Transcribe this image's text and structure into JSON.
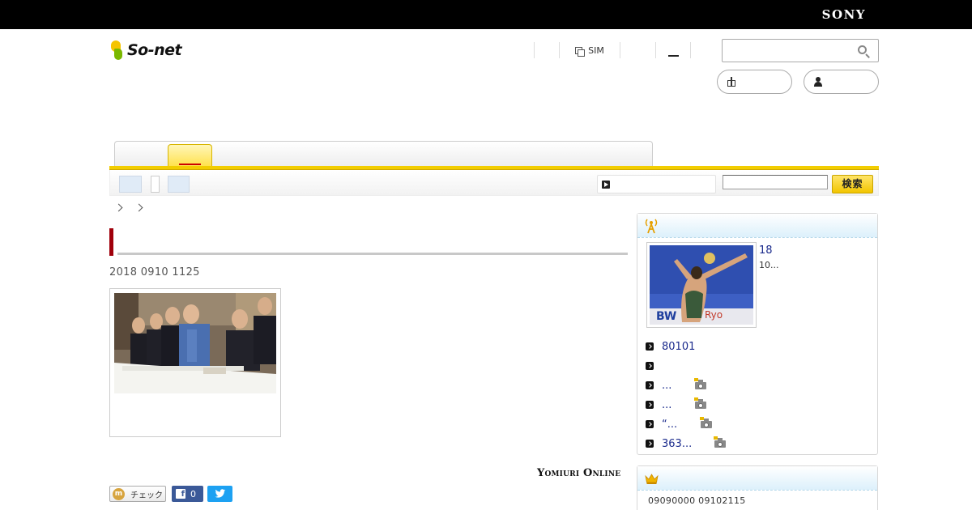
{
  "brand_bar": {
    "label": "SONY"
  },
  "header": {
    "logo_text": "So-net",
    "links": [
      {
        "label": ""
      },
      {
        "label": "SIM",
        "icon": "sim-icon"
      },
      {
        "label": ""
      },
      {
        "label": ""
      }
    ],
    "search": {
      "value": "",
      "placeholder": ""
    },
    "pills": [
      {
        "icon": "gift-icon",
        "label": ""
      },
      {
        "icon": "user-icon",
        "label": ""
      }
    ]
  },
  "subnav": {
    "search_value": "",
    "search_button": "検索"
  },
  "article": {
    "title": "",
    "date": "2018 0910 1125",
    "source": "Yomiuri Online"
  },
  "share": {
    "check_label": "チェック",
    "facebook_count": "0"
  },
  "sidebar": {
    "feature": {
      "headline": "18",
      "subtext": "10..."
    },
    "list": [
      {
        "text": "80101",
        "has_photo": false
      },
      {
        "text": "",
        "has_photo": false
      },
      {
        "text": "...",
        "has_photo": true
      },
      {
        "text": "...",
        "has_photo": true
      },
      {
        "text": "“...",
        "has_photo": true
      },
      {
        "text": "363...",
        "has_photo": true
      }
    ],
    "ranking": {
      "text": "09090000  09102115"
    }
  },
  "colors": {
    "accent_yellow": "#f2cd00",
    "title_red": "#a0000b",
    "link_blue": "#1a2a8c",
    "panel_blue": "#dcf0fb",
    "facebook": "#3b5998",
    "twitter": "#1da1f2"
  }
}
